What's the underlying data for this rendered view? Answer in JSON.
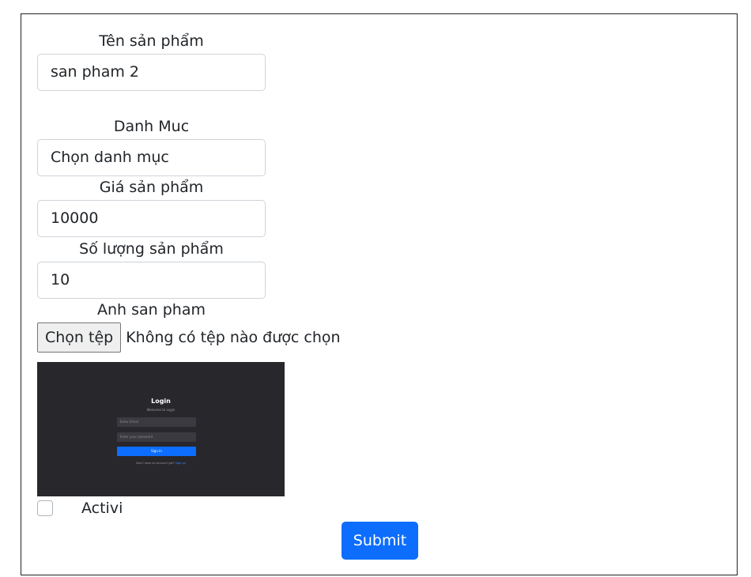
{
  "form": {
    "product_name": {
      "label": "Tên sản phẩm",
      "value": "san pham 2"
    },
    "category": {
      "label": "Danh Muc",
      "value": "Chọn danh mục"
    },
    "price": {
      "label": "Giá sản phẩm",
      "value": "10000"
    },
    "quantity": {
      "label": "Số lượng sản phẩm",
      "value": "10"
    },
    "image": {
      "label": "Anh san pham",
      "button_label": "Chọn tệp",
      "status_text": "Không có tệp nào được chọn"
    },
    "preview": {
      "title": "Login",
      "subtitle": "Welcome to Login",
      "email_placeholder": "Enter Email",
      "password_placeholder": "Enter your password",
      "signin_label": "Sign In",
      "footer_text": "Don't have an account yet?",
      "footer_link": "Sign up"
    },
    "active": {
      "label": "Activi",
      "checked": false
    },
    "submit_label": "Submit"
  },
  "colors": {
    "primary": "#0d6efd",
    "preview_bg": "#28272b",
    "border": "#ced4da"
  }
}
